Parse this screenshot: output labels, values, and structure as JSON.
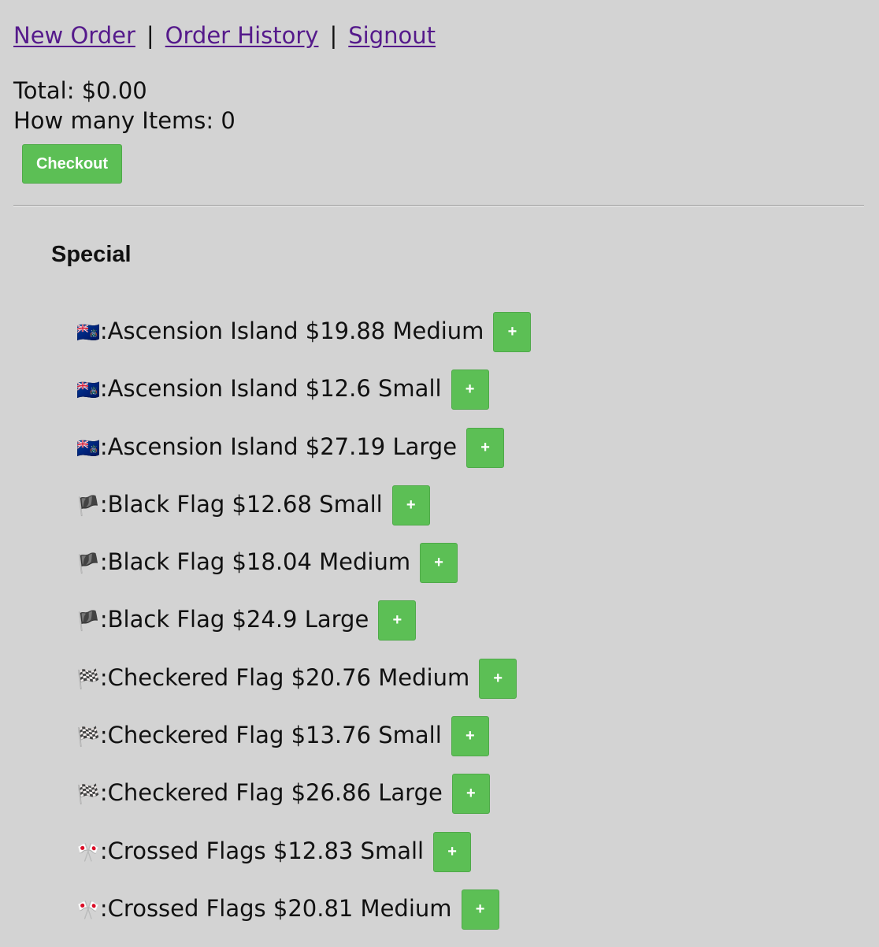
{
  "nav": {
    "new_order": "New Order",
    "order_history": "Order History",
    "signout": "Signout",
    "separator": "|"
  },
  "summary": {
    "total": "Total: $0.00",
    "items_count": "How many Items: 0",
    "checkout_label": "Checkout"
  },
  "section": {
    "title": "Special"
  },
  "items": [
    {
      "flag": "🇦🇨",
      "text": ":Ascension Island $19.88 Medium",
      "add_label": "+"
    },
    {
      "flag": "🇦🇨",
      "text": ":Ascension Island $12.6 Small",
      "add_label": "+"
    },
    {
      "flag": "🇦🇨",
      "text": ":Ascension Island $27.19 Large",
      "add_label": "+"
    },
    {
      "flag": "🏴",
      "text": ":Black Flag $12.68 Small",
      "add_label": "+"
    },
    {
      "flag": "🏴",
      "text": ":Black Flag $18.04 Medium",
      "add_label": "+"
    },
    {
      "flag": "🏴",
      "text": ":Black Flag $24.9 Large",
      "add_label": "+"
    },
    {
      "flag": "🏁",
      "text": ":Checkered Flag $20.76 Medium",
      "add_label": "+"
    },
    {
      "flag": "🏁",
      "text": ":Checkered Flag $13.76 Small",
      "add_label": "+"
    },
    {
      "flag": "🏁",
      "text": ":Checkered Flag $26.86 Large",
      "add_label": "+"
    },
    {
      "flag": "🎌",
      "text": ":Crossed Flags $12.83 Small",
      "add_label": "+"
    },
    {
      "flag": "🎌",
      "text": ":Crossed Flags $20.81 Medium",
      "add_label": "+"
    }
  ],
  "colors": {
    "background": "#d3d3d3",
    "button": "#5cbf55",
    "link": "#551a8b"
  }
}
